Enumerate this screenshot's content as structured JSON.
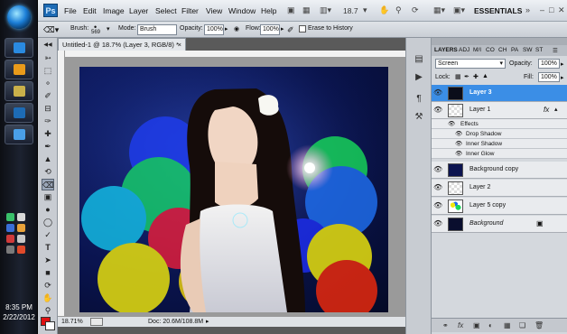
{
  "taskbar": {
    "time": "8:35 PM",
    "date": "2/22/2012"
  },
  "app": {
    "logo": "Ps",
    "menus": [
      "File",
      "Edit",
      "Image",
      "Layer",
      "Select",
      "Filter",
      "View",
      "Window",
      "Help"
    ],
    "zoom_readout": "18.7",
    "workspace": "ESSENTIALS"
  },
  "options_bar": {
    "brush_label": "Brush:",
    "brush_size": "569",
    "mode_label": "Mode:",
    "mode_value": "Brush",
    "opacity_label": "Opacity:",
    "opacity_value": "100%",
    "flow_label": "Flow:",
    "flow_value": "100%",
    "erase_history_label": "Erase to History"
  },
  "document": {
    "tab_title": "Untitled-1 @ 18.7% (Layer 3, RGB/8) *",
    "status_zoom": "18.71%",
    "status_doc": "Doc: 20.6M/108.8M"
  },
  "layers_panel": {
    "tabs": [
      "LAYERS",
      "ADJ",
      "M/I",
      "CO",
      "CH",
      "PA",
      "SW",
      "ST"
    ],
    "blend_mode": "Screen",
    "opacity_label": "Opacity:",
    "opacity_value": "100%",
    "lock_label": "Lock:",
    "fill_label": "Fill:",
    "fill_value": "100%",
    "fx_label": "fx",
    "effects_label": "Effects",
    "layers": [
      {
        "name": "Layer 3",
        "selected": true
      },
      {
        "name": "Layer 1",
        "selected": false
      },
      {
        "name": "Background copy",
        "selected": false
      },
      {
        "name": "Layer 2",
        "selected": false
      },
      {
        "name": "Layer 5 copy",
        "selected": false
      },
      {
        "name": "Background",
        "selected": false
      }
    ],
    "effects": [
      "Drop Shadow",
      "Inner Shadow",
      "Inner Glow"
    ]
  },
  "colors": {
    "selection_blue": "#3b8ee6",
    "foreground_swatch": "#e01010"
  }
}
